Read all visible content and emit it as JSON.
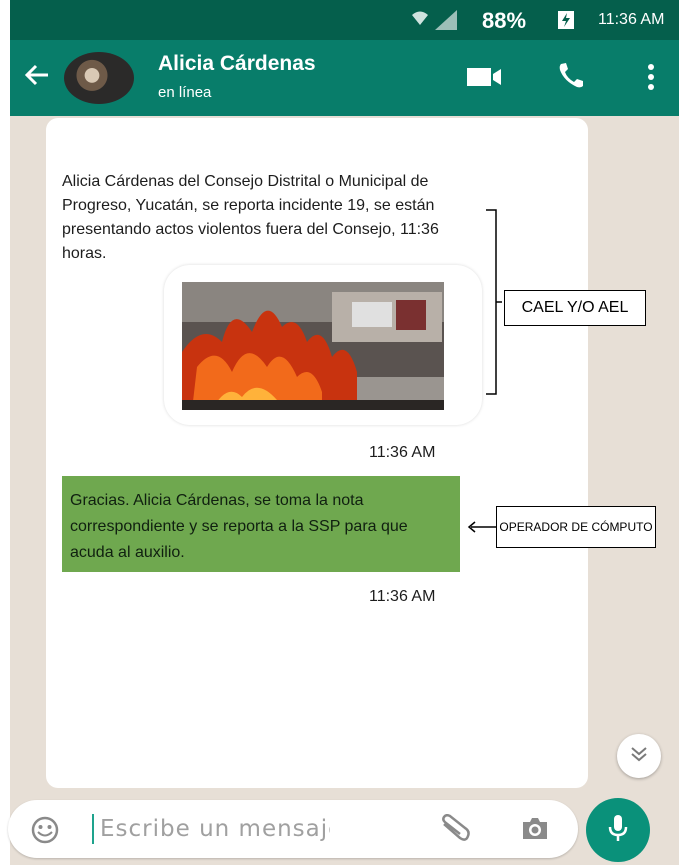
{
  "status_bar": {
    "battery_percent": "88%",
    "time": "11:36 AM",
    "icons": [
      "wifi-icon",
      "signal-icon",
      "battery-charging-icon"
    ]
  },
  "header": {
    "contact_name": "Alicia Cárdenas",
    "contact_status": "en línea",
    "icons": [
      "back-arrow-icon",
      "video-call-icon",
      "phone-icon",
      "more-vert-icon"
    ]
  },
  "chat": {
    "incoming": {
      "text": "Alicia Cárdenas del Consejo Distrital o Municipal de Progreso, Yucatán, se reporta incidente 19, se están presentando actos violentos fuera del Consejo, 11:36 horas.",
      "time": "11:36 AM"
    },
    "annotation_sender": "CAEL Y/O AEL",
    "reply": {
      "text": "Gracias. Alicia Cárdenas, se toma la nota correspondiente y se reporta a la SSP para que acuda al auxilio.",
      "time": "11:36 AM"
    },
    "annotation_operator": "OPERADOR DE CÓMPUTO"
  },
  "input": {
    "placeholder": "Escribe un mensaje",
    "icons": [
      "emoji-icon",
      "attach-icon",
      "camera-icon",
      "mic-icon"
    ]
  },
  "colors": {
    "status_bar": "#055f4c",
    "app_bar": "#087d6a",
    "reply_highlight": "#6fa84f",
    "mic_button": "#0a917a"
  }
}
